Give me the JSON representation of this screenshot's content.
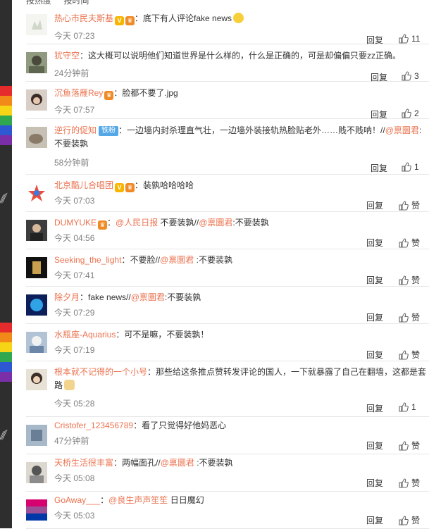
{
  "sort": {
    "hot": "按热度",
    "time": "按时间"
  },
  "reply_label": "回复",
  "like_label": "赞",
  "colors": {
    "name": "#eb7350",
    "text": "#333333",
    "time": "#808080",
    "sidebar": "#2e2e2e"
  },
  "comments": [
    {
      "user": "热心市民夫斯基",
      "sep": "：",
      "segments": [
        {
          "t": "底下有人评论fake news",
          "m": false
        }
      ],
      "time": "今天 07:23",
      "likes": "11"
    },
    {
      "user": "犹守空",
      "sep": "：",
      "segments": [
        {
          "t": "这大概可以说明他们知道世界是什么样的，什么是正确的，可是却偏偏只要zz正确。",
          "m": false
        }
      ],
      "time": "24分钟前",
      "likes": "3"
    },
    {
      "user": "沉鱼落雁Rey",
      "sep": "：",
      "segments": [
        {
          "t": "脸都不要了.jpg",
          "m": false
        }
      ],
      "time": "今天 07:57",
      "likes": "2"
    },
    {
      "user": "逆行的促知",
      "fans": "铁粉",
      "sep": "：",
      "segments": [
        {
          "t": "一边墙内封杀理直气壮，一边墙外装接轨热脸贴老外……贱不贱呐！//",
          "m": false
        },
        {
          "t": "@禀圜君",
          "m": true
        },
        {
          "t": ":不要装孰",
          "m": false
        }
      ],
      "time": "58分钟前",
      "likes": "1"
    },
    {
      "user": "北京酷儿合唱团",
      "sep": "：",
      "segments": [
        {
          "t": "装孰哈哈哈哈",
          "m": false
        }
      ],
      "time": "今天 07:03",
      "likes": "赞"
    },
    {
      "user": "DUMYUKE",
      "sep": "：",
      "segments": [
        {
          "t": "@人民日报",
          "m": true
        },
        {
          "t": " 不要装孰//",
          "m": false
        },
        {
          "t": "@禀圜君",
          "m": true
        },
        {
          "t": ":不要装孰",
          "m": false
        }
      ],
      "time": "今天 04:56",
      "likes": "赞"
    },
    {
      "user": "Seeking_the_light",
      "sep": "：",
      "segments": [
        {
          "t": "不要脸//",
          "m": false
        },
        {
          "t": "@禀圜君",
          "m": true
        },
        {
          "t": " :不要装孰",
          "m": false
        }
      ],
      "time": "今天 07:41",
      "likes": "赞"
    },
    {
      "user": "除夕月",
      "sep": "：",
      "segments": [
        {
          "t": "fake news//",
          "m": false
        },
        {
          "t": "@禀圜君",
          "m": true
        },
        {
          "t": ":不要装孰",
          "m": false
        }
      ],
      "time": "今天 07:29",
      "likes": "赞"
    },
    {
      "user": "水瓶座-Aquarius",
      "sep": "：",
      "segments": [
        {
          "t": "可不是嘛，不要装孰！",
          "m": false
        }
      ],
      "time": "今天 07:19",
      "likes": "赞"
    },
    {
      "user": "根本就不记得的一个小号",
      "sep": "：",
      "segments": [
        {
          "t": "那些给这条推点赞转发评论的国人，一下就暴露了自己在翻墙，这都是套路",
          "m": false
        }
      ],
      "time": "今天 05:28",
      "likes": "1"
    },
    {
      "user": "Cristofer_123456789",
      "sep": "：",
      "segments": [
        {
          "t": "看了只觉得好他妈恶心",
          "m": false
        }
      ],
      "time": "47分钟前",
      "likes": "赞"
    },
    {
      "user": "天桥生活很丰富",
      "sep": "：",
      "segments": [
        {
          "t": "两幅面孔//",
          "m": false
        },
        {
          "t": "@禀圜君",
          "m": true
        },
        {
          "t": " :不要装孰",
          "m": false
        }
      ],
      "time": "今天 05:08",
      "likes": "赞"
    },
    {
      "user": "GoAway___",
      "sep": "：",
      "segments": [
        {
          "t": "@良生声声笙笙",
          "m": true
        },
        {
          "t": " 日日魔幻",
          "m": false
        }
      ],
      "time": "今天 05:03",
      "likes": "赞"
    }
  ]
}
